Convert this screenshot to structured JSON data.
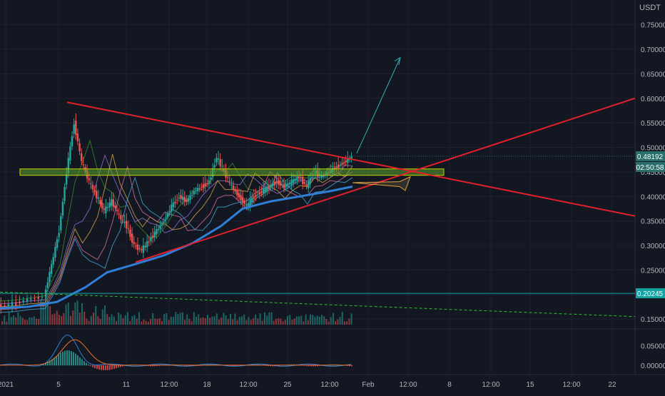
{
  "currency_label": "USDT",
  "price_badges": {
    "last_price": "0.48192",
    "countdown": "02:50:58",
    "horizontal_level": "0.20245"
  },
  "colors": {
    "background": "#131722",
    "grid": "#1e2230",
    "axis_text": "#b2b5be",
    "candle_up": "#26a69a",
    "candle_down": "#ef5350",
    "triangle": "#e0202b",
    "zone_fill": "#5aa02c",
    "zone_border": "#c8d200",
    "projection_arrow": "#2fb3b3",
    "ma_thick": "#2f7fd8",
    "badge_price": "#2a6f6b",
    "badge_level": "#14a3a3"
  },
  "chart_data": {
    "type": "candlestick",
    "symbol_quote": "USDT",
    "ylim": [
      0.14,
      0.78
    ],
    "y_ticks": [
      "0.75000",
      "0.70000",
      "0.65000",
      "0.60000",
      "0.55000",
      "0.50000",
      "0.45000",
      "0.40000",
      "0.35000",
      "0.30000",
      "0.25000",
      "0.20000",
      "0.15000"
    ],
    "x_ticks": [
      "2021",
      "5",
      "11",
      "12:00",
      "18",
      "12:00",
      "25",
      "12:00",
      "Feb",
      "12:00",
      "8",
      "12:00",
      "15",
      "12:00",
      "22"
    ],
    "last_price": 0.48192,
    "horizontal_level": 0.20245,
    "price_path": [
      [
        0,
        0.175
      ],
      [
        2,
        0.18
      ],
      [
        4,
        0.19
      ],
      [
        6,
        0.195
      ],
      [
        7,
        0.26
      ],
      [
        8,
        0.33
      ],
      [
        9,
        0.45
      ],
      [
        10,
        0.55
      ],
      [
        11,
        0.47
      ],
      [
        12,
        0.43
      ],
      [
        13,
        0.4
      ],
      [
        14,
        0.37
      ],
      [
        15,
        0.39
      ],
      [
        16,
        0.36
      ],
      [
        17,
        0.34
      ],
      [
        18,
        0.3
      ],
      [
        19,
        0.29
      ],
      [
        20,
        0.31
      ],
      [
        21,
        0.33
      ],
      [
        22,
        0.35
      ],
      [
        23,
        0.38
      ],
      [
        24,
        0.4
      ],
      [
        25,
        0.39
      ],
      [
        26,
        0.41
      ],
      [
        27,
        0.42
      ],
      [
        28,
        0.43
      ],
      [
        29,
        0.48
      ],
      [
        30,
        0.45
      ],
      [
        31,
        0.42
      ],
      [
        32,
        0.4
      ],
      [
        33,
        0.38
      ],
      [
        34,
        0.4
      ],
      [
        35,
        0.41
      ],
      [
        36,
        0.42
      ],
      [
        37,
        0.43
      ],
      [
        38,
        0.42
      ],
      [
        39,
        0.43
      ],
      [
        40,
        0.44
      ],
      [
        41,
        0.42
      ],
      [
        42,
        0.45
      ],
      [
        43,
        0.44
      ],
      [
        44,
        0.45
      ],
      [
        45,
        0.46
      ],
      [
        46,
        0.47
      ],
      [
        47,
        0.48
      ]
    ],
    "oscillator": {
      "y_ticks": [
        "0.05000",
        "0.00000"
      ],
      "ylim": [
        -0.015,
        0.085
      ]
    }
  }
}
